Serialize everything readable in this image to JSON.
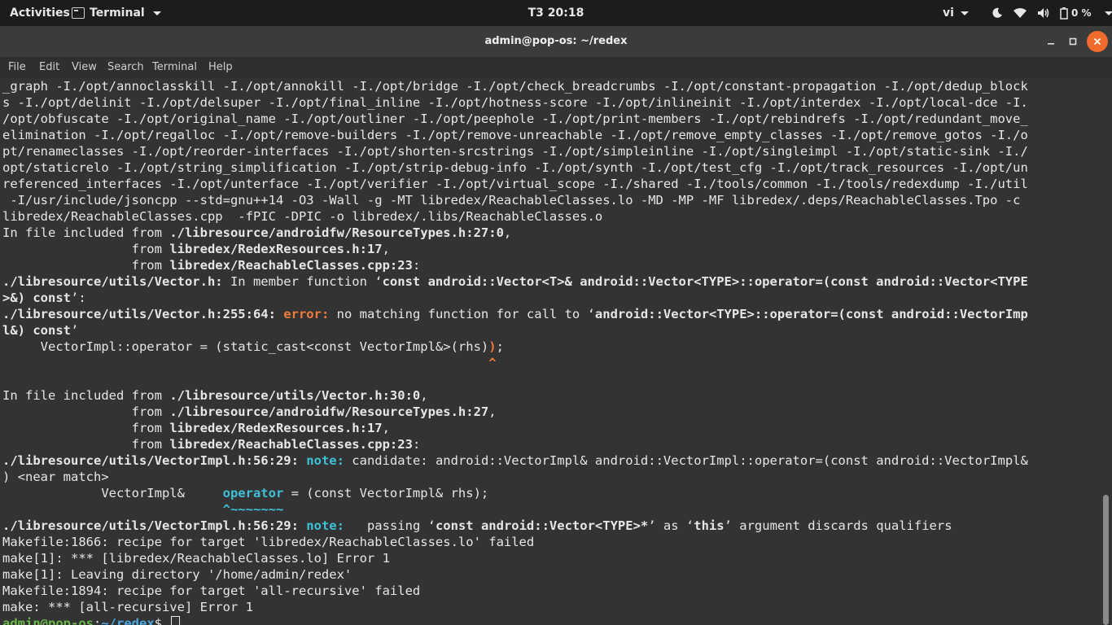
{
  "topbar": {
    "activities": "Activities",
    "app_name": "Terminal",
    "clock": "T3 20:18",
    "lang": "vi",
    "battery": "0 %"
  },
  "window": {
    "title": "admin@pop-os: ~/redex",
    "menu": [
      "File",
      "Edit",
      "View",
      "Search",
      "Terminal",
      "Help"
    ]
  },
  "terminal": {
    "lines": [
      [
        "_graph -I./opt/annoclasskill -I./opt/annokill -I./opt/bridge -I./opt/check_breadcrumbs -I./opt/constant-propagation -I./opt/dedup_block"
      ],
      [
        "s -I./opt/delinit -I./opt/delsuper -I./opt/final_inline -I./opt/hotness-score -I./opt/inlineinit -I./opt/interdex -I./opt/local-dce -I."
      ],
      [
        "/opt/obfuscate -I./opt/original_name -I./opt/outliner -I./opt/peephole -I./opt/print-members -I./opt/rebindrefs -I./opt/redundant_move_"
      ],
      [
        "elimination -I./opt/regalloc -I./opt/remove-builders -I./opt/remove-unreachable -I./opt/remove_empty_classes -I./opt/remove_gotos -I./o"
      ],
      [
        "pt/renameclasses -I./opt/reorder-interfaces -I./opt/shorten-srcstrings -I./opt/simpleinline -I./opt/singleimpl -I./opt/static-sink -I./"
      ],
      [
        "opt/staticrelo -I./opt/string_simplification -I./opt/strip-debug-info -I./opt/synth -I./opt/test_cfg -I./opt/track_resources -I./opt/un"
      ],
      [
        "referenced_interfaces -I./opt/unterface -I./opt/verifier -I./opt/virtual_scope -I./shared -I./tools/common -I./tools/redexdump -I./util"
      ],
      [
        " -I/usr/include/jsoncpp --std=gnu++14 -O3 -Wall -g -MT libredex/ReachableClasses.lo -MD -MP -MF libredex/.deps/ReachableClasses.Tpo -c"
      ],
      [
        "libredex/ReachableClasses.cpp  -fPIC -DPIC -o libredex/.libs/ReachableClasses.o"
      ],
      [
        "In file included from ",
        "./libresource/androidfw/ResourceTypes.h:27:0",
        ","
      ],
      [
        "                 from ",
        "libredex/RedexResources.h:17",
        ","
      ],
      [
        "                 from ",
        "libredex/ReachableClasses.cpp:23",
        ":"
      ],
      [
        "./libresource/utils/Vector.h:",
        " In member function ‘",
        "const android::Vector<T>& android::Vector<TYPE>::operator=(const android::Vector<TYPE"
      ],
      [
        ">&) const",
        "’:"
      ],
      [
        "./libresource/utils/Vector.h:255:64:",
        " ",
        "error:",
        " no matching function for call to ‘",
        "android::Vector<TYPE>::operator=(const android::VectorImp"
      ],
      [
        "l&) const",
        "’"
      ],
      [
        "     VectorImpl::operator = (static_cast<const VectorImpl&>(rhs)",
        ")",
        ";"
      ],
      [
        "                                                                ",
        "^"
      ],
      [
        ""
      ],
      [
        "In file included from ",
        "./libresource/utils/Vector.h:30:0",
        ","
      ],
      [
        "                 from ",
        "./libresource/androidfw/ResourceTypes.h:27",
        ","
      ],
      [
        "                 from ",
        "libredex/RedexResources.h:17",
        ","
      ],
      [
        "                 from ",
        "libredex/ReachableClasses.cpp:23",
        ":"
      ],
      [
        "./libresource/utils/VectorImpl.h:56:29:",
        " ",
        "note:",
        " candidate: android::VectorImpl& android::VectorImpl::operator=(const android::VectorImpl&"
      ],
      [
        ") <near match>"
      ],
      [
        "             VectorImpl&     ",
        "operator",
        " = (const VectorImpl& rhs);"
      ],
      [
        "                             ",
        "^~~~~~~~"
      ],
      [
        "./libresource/utils/VectorImpl.h:56:29:",
        " ",
        "note:",
        "   passing ‘",
        "const android::Vector<TYPE>*",
        "’ as ‘",
        "this",
        "’ argument discards qualifiers"
      ],
      [
        "Makefile:1866: recipe for target 'libredex/ReachableClasses.lo' failed"
      ],
      [
        "make[1]: *** [libredex/ReachableClasses.lo] Error 1"
      ],
      [
        "make[1]: Leaving directory '/home/admin/redex'"
      ],
      [
        "Makefile:1894: recipe for target 'all-recursive' failed"
      ],
      [
        "make: *** [all-recursive] Error 1"
      ]
    ],
    "prompt_user": "admin@pop-os",
    "prompt_sep": ":",
    "prompt_path": "~/redex",
    "prompt_symbol": "$ "
  },
  "icons": [
    "terminal-app-icon",
    "moon-icon",
    "wifi-icon",
    "volume-icon",
    "battery-icon",
    "minimize-icon",
    "maximize-icon",
    "close-icon"
  ],
  "colors": {
    "error": "#f07a3a",
    "note": "#3fc0d8",
    "prompt_user": "#6ab84a",
    "prompt_path": "#4aa7e0",
    "close_button": "#f06b2c"
  }
}
